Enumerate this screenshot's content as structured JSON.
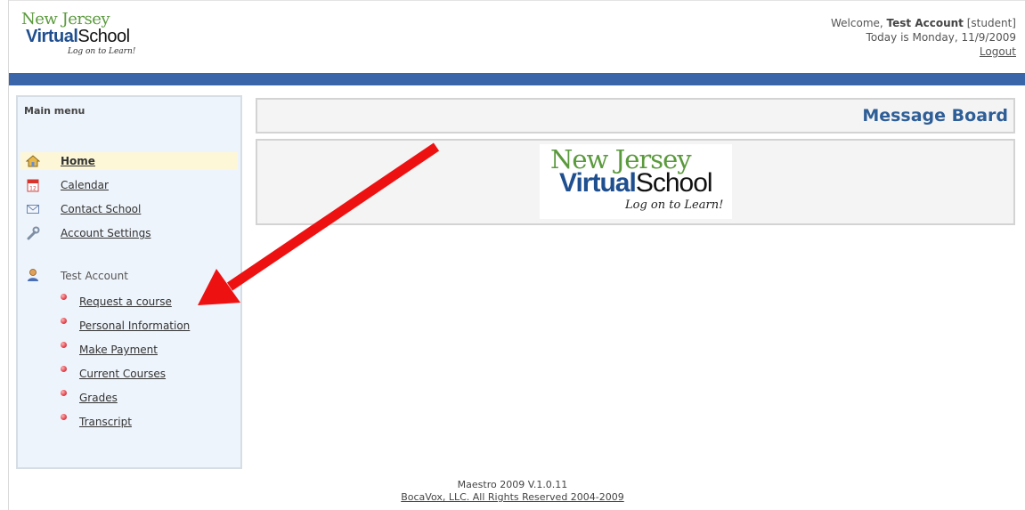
{
  "header": {
    "logo": {
      "line1": "New Jersey",
      "brand_bold": "Virtual",
      "brand_regular": "School",
      "tagline": "Log on to Learn!"
    },
    "welcome_prefix": "Welcome, ",
    "user_name": "Test Account",
    "user_role": "[student]",
    "today": "Today is Monday, 11/9/2009",
    "logout_label": "Logout"
  },
  "sidebar": {
    "title": "Main menu",
    "items": [
      {
        "label": "Home",
        "icon": "home-icon",
        "active": true
      },
      {
        "label": "Calendar",
        "icon": "calendar-icon"
      },
      {
        "label": "Contact School",
        "icon": "envelope-icon"
      },
      {
        "label": "Account Settings",
        "icon": "wrench-icon"
      }
    ],
    "user_section": {
      "label": "Test Account",
      "icon": "user-icon"
    },
    "sub_items": [
      {
        "label": "Request a course"
      },
      {
        "label": "Personal Information"
      },
      {
        "label": "Make Payment"
      },
      {
        "label": "Current Courses"
      },
      {
        "label": "Grades"
      },
      {
        "label": "Transcript"
      }
    ]
  },
  "main": {
    "title": "Message Board",
    "logo": {
      "line1": "New Jersey",
      "brand_bold": "Virtual",
      "brand_regular": "School",
      "tagline": "Log on to Learn!"
    }
  },
  "footer": {
    "version": "Maestro 2009 V.1.0.11",
    "copyright": "BocaVox, LLC. All Rights Reserved 2004-2009"
  },
  "colors": {
    "accent_bar": "#3a66a9",
    "title_blue": "#2e5e97",
    "annotation_arrow": "#ee1111"
  }
}
